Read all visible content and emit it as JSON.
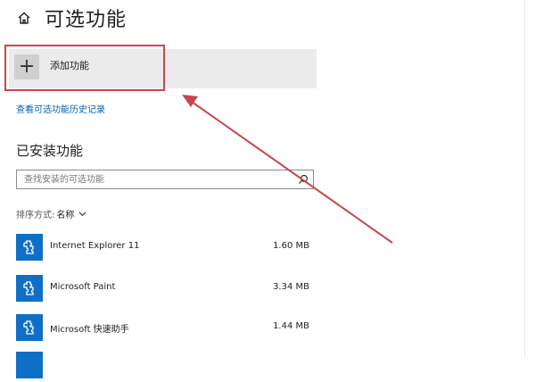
{
  "header": {
    "title": "可选功能",
    "home_icon": "home-icon"
  },
  "add_feature": {
    "label": "添加功能",
    "icon": "plus-icon"
  },
  "history_link": "查看可选功能历史记录",
  "installed": {
    "title": "已安装功能",
    "search_placeholder": "查找安装的可选功能",
    "sort_label": "排序方式:",
    "sort_value": "名称"
  },
  "features": [
    {
      "name": "Internet Explorer 11",
      "size": "1.60 MB",
      "icon": "puzzle-icon"
    },
    {
      "name": "Microsoft Paint",
      "size": "3.34 MB",
      "icon": "puzzle-icon"
    },
    {
      "name": "Microsoft 快速助手",
      "size": "1.44 MB",
      "icon": "puzzle-icon"
    }
  ],
  "colors": {
    "accent": "#0f6fc6",
    "link": "#0063b1",
    "annotation": "#c8474e",
    "add_row_bg": "#ebebeb"
  }
}
